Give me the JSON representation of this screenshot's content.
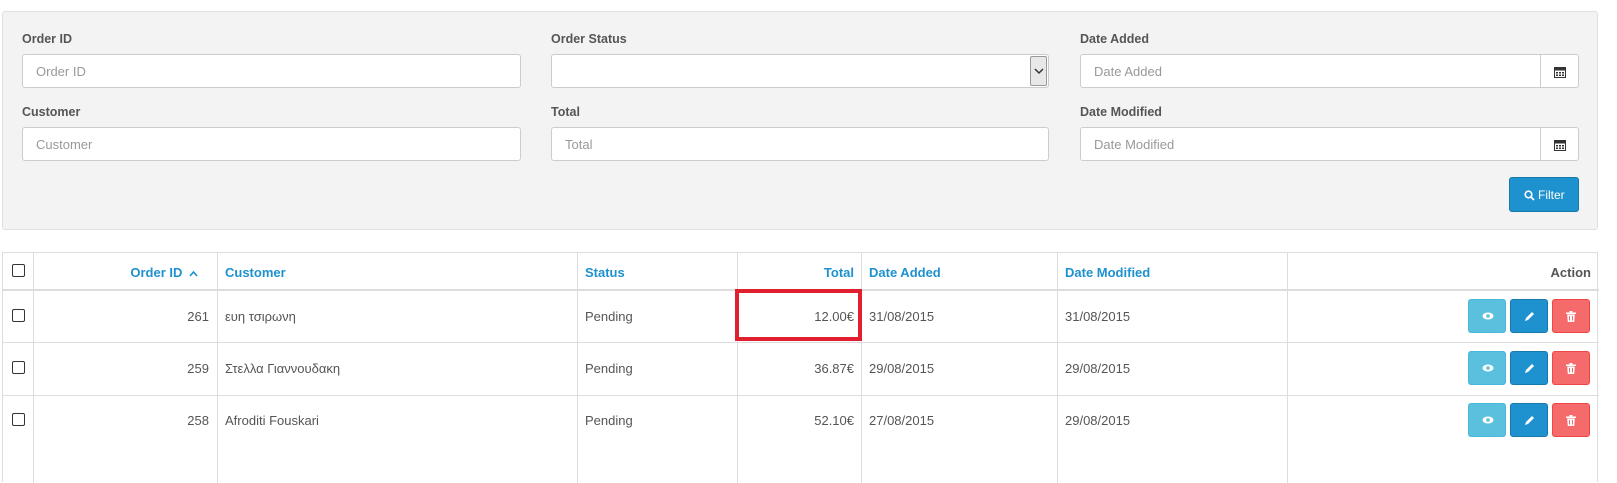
{
  "filters": {
    "order_id": {
      "label": "Order ID",
      "placeholder": "Order ID",
      "value": ""
    },
    "order_status": {
      "label": "Order Status",
      "value": ""
    },
    "date_added": {
      "label": "Date Added",
      "placeholder": "Date Added",
      "value": ""
    },
    "customer": {
      "label": "Customer",
      "placeholder": "Customer",
      "value": ""
    },
    "total": {
      "label": "Total",
      "placeholder": "Total",
      "value": ""
    },
    "date_modified": {
      "label": "Date Modified",
      "placeholder": "Date Modified",
      "value": ""
    },
    "filter_button": "Filter"
  },
  "table": {
    "headers": {
      "order_id": "Order ID",
      "customer": "Customer",
      "status": "Status",
      "total": "Total",
      "date_added": "Date Added",
      "date_modified": "Date Modified",
      "action": "Action"
    },
    "rows": [
      {
        "order_id": "261",
        "customer": "ευη τσιρωνη",
        "status": "Pending",
        "total": "12.00€",
        "date_added": "31/08/2015",
        "date_modified": "31/08/2015"
      },
      {
        "order_id": "259",
        "customer": "Στελλα Γιαννουδακη",
        "status": "Pending",
        "total": "36.87€",
        "date_added": "29/08/2015",
        "date_modified": "29/08/2015"
      },
      {
        "order_id": "258",
        "customer": "Afroditi Fouskari",
        "status": "Pending",
        "total": "52.10€",
        "date_added": "27/08/2015",
        "date_modified": "29/08/2015"
      }
    ]
  },
  "icons": {
    "sort": "chevron-up-icon",
    "calendar": "calendar-icon",
    "filter": "search-icon",
    "view": "eye-icon",
    "edit": "pencil-icon",
    "delete": "trash-icon"
  },
  "colors": {
    "link": "#1e91cf",
    "view_button": "#5bc0de",
    "edit_button": "#1e91cf",
    "delete_button": "#f56b6b",
    "highlight": "#e0202f"
  }
}
